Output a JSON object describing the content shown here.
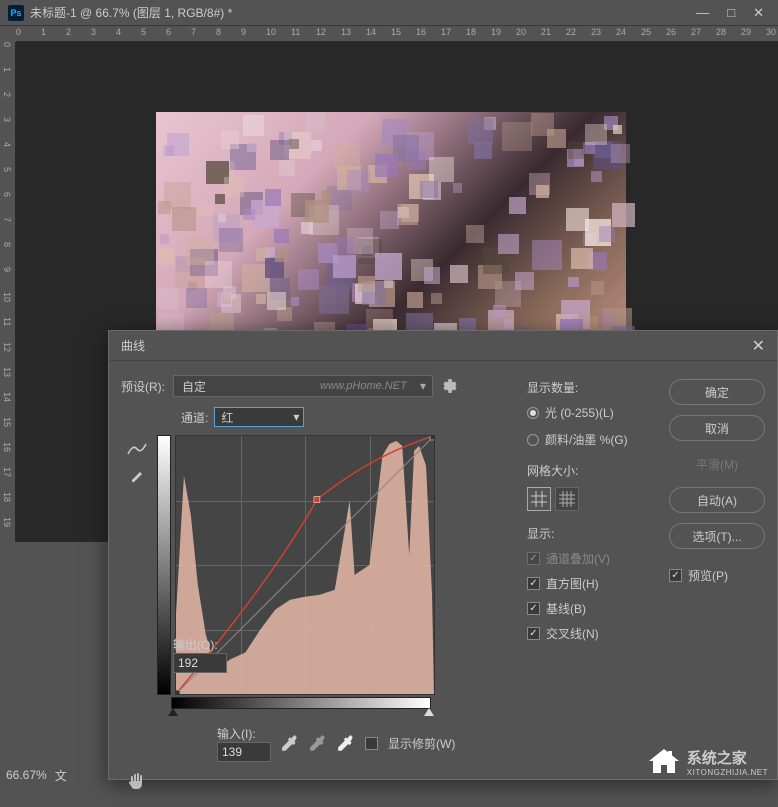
{
  "title": "未标题-1 @ 66.7% (图层 1, RGB/8#) *",
  "ruler_h": [
    "0",
    "1",
    "2",
    "3",
    "4",
    "5",
    "6",
    "7",
    "8",
    "9",
    "10",
    "11",
    "12",
    "13",
    "14",
    "15",
    "16",
    "17",
    "18",
    "19",
    "20",
    "21",
    "22",
    "23",
    "24",
    "25",
    "26",
    "27",
    "28",
    "29",
    "30"
  ],
  "ruler_v": [
    "0",
    "1",
    "2",
    "3",
    "4",
    "5",
    "6",
    "7",
    "8",
    "9",
    "10",
    "11",
    "12",
    "13",
    "14",
    "15",
    "16",
    "17",
    "18",
    "19"
  ],
  "status": {
    "zoom": "66.67%",
    "doc": "文"
  },
  "dialog": {
    "title": "曲线",
    "preset_label": "预设(R):",
    "preset_value": "自定",
    "watermark": "www.pHome.NET",
    "channel_label": "通道:",
    "channel_value": "红",
    "output_label": "输出(O):",
    "output_value": "192",
    "input_label": "输入(I):",
    "input_value": "139",
    "show_clip": "显示修剪(W)",
    "display": {
      "title": "显示数量:",
      "light": "光 (0-255)(L)",
      "pigment": "颜料/油墨 %(G)"
    },
    "grid": {
      "title": "网格大小:"
    },
    "show": {
      "title": "显示:",
      "overlay": "通道叠加(V)",
      "histogram": "直方图(H)",
      "baseline": "基线(B)",
      "intersection": "交叉线(N)"
    },
    "buttons": {
      "ok": "确定",
      "cancel": "取消",
      "smooth": "平滑(M)",
      "auto": "自动(A)",
      "options": "选项(T)..."
    },
    "preview": "预览(P)"
  },
  "logo": {
    "name": "系统之家",
    "url": "XITONGZHIJIA.NET"
  },
  "chart_data": {
    "type": "curve",
    "channel": "red",
    "input_range": [
      0,
      255
    ],
    "output_range": [
      0,
      255
    ],
    "points": [
      [
        0,
        0
      ],
      [
        139,
        192
      ]
    ],
    "histogram_peaks": "dense shadows 0-40, sparse midtones, very tall highlights 200-255"
  }
}
